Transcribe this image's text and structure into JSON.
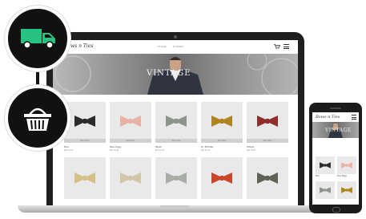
{
  "site": {
    "brand": "Bows n Ties",
    "nav": [
      "PLANE",
      "PLANES"
    ],
    "hero_text": "VINTAGE"
  },
  "products": [
    {
      "name": "Bow",
      "price": "$00 00.00",
      "color": "#2b2b2b",
      "button": "See more"
    },
    {
      "name": "Miss Piggy",
      "price": "$00 00.00",
      "color": "#e8b2a6",
      "button": "See more"
    },
    {
      "name": "Micah",
      "price": "$00 00.00",
      "color": "#8c948c",
      "button": "See more"
    },
    {
      "name": "Dr. Birthday",
      "price": "$00 00.00",
      "color": "#b0841f",
      "button": "See more"
    },
    {
      "name": "Phelps",
      "price": "$00 00.00",
      "color": "#8e2f2c",
      "button": "See more"
    },
    {
      "name": "",
      "price": "",
      "color": "#d6c08a",
      "button": ""
    },
    {
      "name": "",
      "price": "",
      "color": "#d2c6a8",
      "button": ""
    },
    {
      "name": "",
      "price": "",
      "color": "#a8ada6",
      "button": ""
    },
    {
      "name": "",
      "price": "",
      "color": "#c9482a",
      "button": ""
    },
    {
      "name": "",
      "price": "",
      "color": "#5f6356",
      "button": ""
    }
  ],
  "phone": {
    "brand": "Bows n Ties",
    "hero_text": "VINTAGE",
    "products": [
      {
        "name": "Bow",
        "color": "#2b2b2b"
      },
      {
        "name": "Miss Piggy",
        "color": "#e8b2a6"
      },
      {
        "name": "",
        "color": "#8c948c"
      },
      {
        "name": "",
        "color": "#b0841f"
      }
    ]
  },
  "icons": {
    "delivery": "truck-icon",
    "basket": "basket-icon",
    "truck_color": "#26c281",
    "circle_color": "#111111"
  }
}
